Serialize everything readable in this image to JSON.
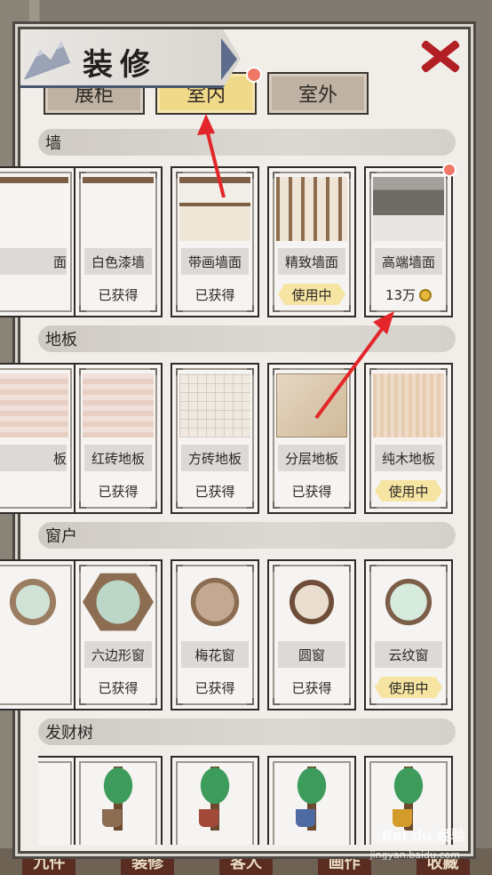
{
  "title": "装修",
  "tabs": [
    {
      "label": "展柜",
      "active": false,
      "has_dot": true
    },
    {
      "label": "室内",
      "active": true,
      "has_dot": true
    },
    {
      "label": "室外",
      "active": false,
      "has_dot": false
    }
  ],
  "sections": {
    "wall": {
      "title": "墙",
      "items": [
        {
          "name": "面",
          "status": ""
        },
        {
          "name": "白色漆墙",
          "status": "已获得"
        },
        {
          "name": "带画墙面",
          "status": "已获得"
        },
        {
          "name": "精致墙面",
          "status": "使用中"
        },
        {
          "name": "高端墙面",
          "price": "13万"
        }
      ]
    },
    "floor": {
      "title": "地板",
      "items": [
        {
          "name": "板",
          "status": ""
        },
        {
          "name": "红砖地板",
          "status": "已获得"
        },
        {
          "name": "方砖地板",
          "status": "已获得"
        },
        {
          "name": "分层地板",
          "status": "已获得"
        },
        {
          "name": "纯木地板",
          "status": "使用中"
        }
      ]
    },
    "window": {
      "title": "窗户",
      "items": [
        {
          "name": "",
          "status": ""
        },
        {
          "name": "六边形窗",
          "status": "已获得"
        },
        {
          "name": "梅花窗",
          "status": "已获得"
        },
        {
          "name": "圆窗",
          "status": "已获得"
        },
        {
          "name": "云纹窗",
          "status": "使用中"
        }
      ]
    },
    "tree": {
      "title": "发财树"
    }
  },
  "bottom_nav": [
    "九件",
    "装修",
    "客人",
    "画作",
    "收藏"
  ],
  "watermark": {
    "brand": "Bai du 经验",
    "url": "jingyan.baidu.com"
  },
  "colors": {
    "accent_red": "#b21f24",
    "tab_active": "#f1d98a",
    "badge": "#f07867"
  }
}
